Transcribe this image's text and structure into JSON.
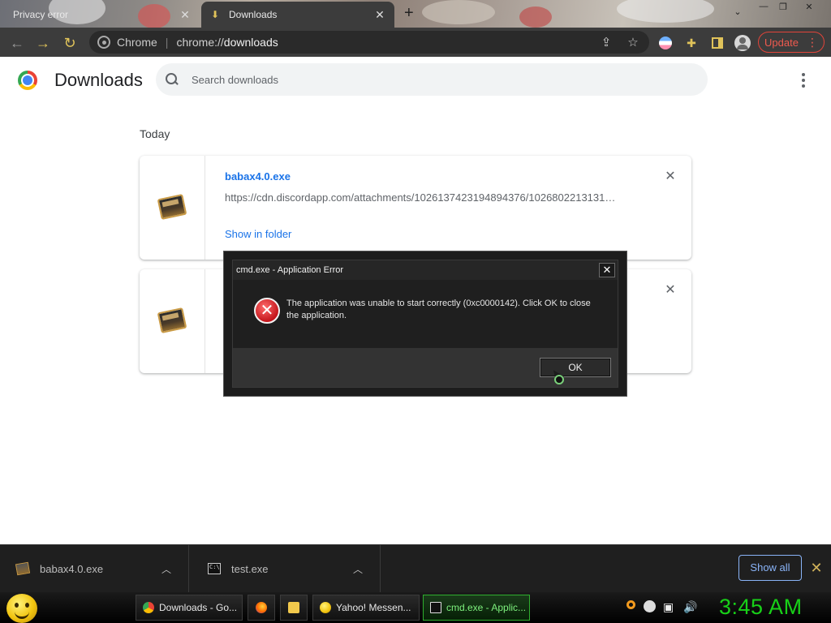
{
  "tabs": [
    {
      "title": "Privacy error",
      "active": false
    },
    {
      "title": "Downloads",
      "active": true
    }
  ],
  "toolbar": {
    "scheme_label": "Chrome",
    "url_prefix": "chrome://",
    "url_host": "downloads",
    "update_label": "Update"
  },
  "page": {
    "title": "Downloads",
    "search_placeholder": "Search downloads",
    "date_heading": "Today"
  },
  "downloads": [
    {
      "name": "babax4.0.exe",
      "url": "https://cdn.discordapp.com/attachments/1026137423194894376/1026802213131…",
      "action": "Show in folder"
    },
    {
      "name": "",
      "url": "",
      "action": ""
    }
  ],
  "dialog": {
    "title": "cmd.exe - Application Error",
    "message": "The application was unable to start correctly (0xc0000142). Click OK to close the application.",
    "ok_label": "OK",
    "close_glyph": "✕"
  },
  "shelf": {
    "items": [
      {
        "name": "babax4.0.exe",
        "icon": "exe-file-icon"
      },
      {
        "name": "test.exe",
        "icon": "cmd-file-icon"
      }
    ],
    "show_all_label": "Show all"
  },
  "taskbar": {
    "tasks": [
      {
        "label": "Downloads - Go...",
        "icon": "chrome-icon",
        "active": false
      },
      {
        "label": "Yahoo! Messen...",
        "icon": "yahoo-messenger-icon",
        "active": false
      },
      {
        "label": "cmd.exe - Applic...",
        "icon": "cmd-icon",
        "active": true
      }
    ],
    "clock": "3:45 AM"
  },
  "colors": {
    "accent_blue": "#1a73e8",
    "update_red": "#ef5a4f",
    "clock_green": "#18d018",
    "error_red": "#c4161c"
  }
}
